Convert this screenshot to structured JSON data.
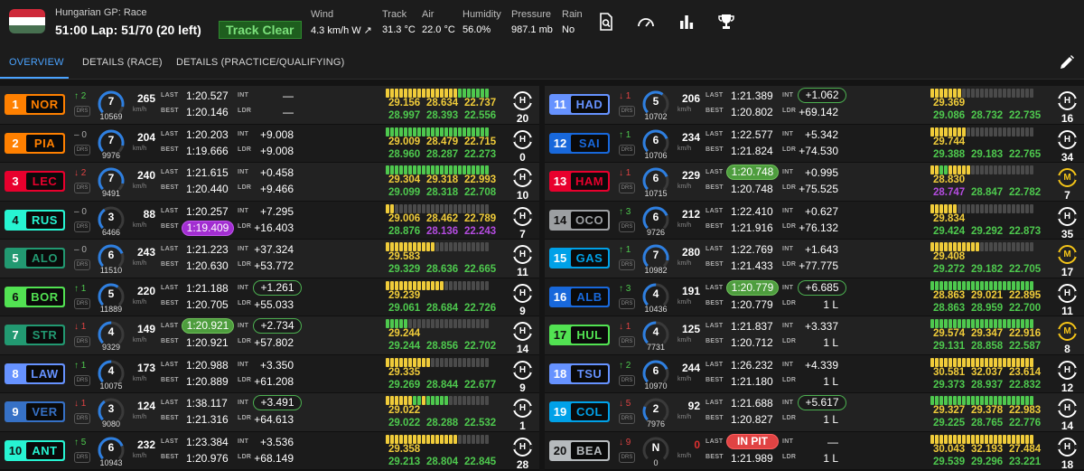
{
  "header": {
    "race_label": "Hungarian GP: Race",
    "lap_text": "51:00 Lap: 51/70 (20 left)",
    "track_status": "Track Clear",
    "weather": [
      {
        "label": "Wind",
        "value": "4.3 km/h W ↗"
      },
      {
        "label": "Track",
        "value": "31.3 °C"
      },
      {
        "label": "Air",
        "value": "22.0 °C"
      },
      {
        "label": "Humidity",
        "value": "56.0%"
      },
      {
        "label": "Pressure",
        "value": "987.1 mb"
      },
      {
        "label": "Rain",
        "value": "No"
      }
    ],
    "toolbar_icons": [
      "search-document-icon",
      "gauge-icon",
      "bar-chart-icon",
      "trophy-icon"
    ]
  },
  "tabs": {
    "overview": "OVERVIEW",
    "details_race": "DETAILS (RACE)",
    "details_pq": "DETAILS (PRACTICE/QUALIFYING)"
  },
  "labels": {
    "last": "LAST",
    "best": "BEST",
    "int": "INT",
    "ldr": "LDR",
    "kmh": "km/h",
    "drs": "DRS"
  },
  "colors": {
    "yellow": "#f0cc3a",
    "green": "#4ec94e",
    "purple": "#b44ce0",
    "grey": "#4a4a4a"
  },
  "drivers": [
    {
      "pos": "1",
      "code": "NOR",
      "team": "#ff8000",
      "pc": "↑",
      "pv": "2",
      "dir": "up",
      "gear": "7",
      "rpm": "10569",
      "speed": "265",
      "last": "1:20.527",
      "best": "1:20.146",
      "int": "—",
      "ldr": "—",
      "segs": "yyyyyyyyyyyyyyyyggggggg",
      "s1": "29.156",
      "s2": "28.634",
      "s3": "22.737",
      "b1": "28.997",
      "b2": "28.393",
      "b3": "22.556",
      "tyre": "H",
      "age": "20"
    },
    {
      "pos": "2",
      "code": "PIA",
      "team": "#ff8000",
      "pc": "–",
      "pv": "0",
      "dir": "eq",
      "gear": "7",
      "rpm": "9976",
      "speed": "204",
      "last": "1:20.203",
      "best": "1:19.666",
      "int": "+9.008",
      "ldr": "+9.008",
      "segs": "ggggggggggggggggggggggg",
      "s1": "29.009",
      "s2": "28.479",
      "s3": "22.715",
      "b1": "28.960",
      "b2": "28.287",
      "b3": "22.273",
      "tyre": "H",
      "age": "0"
    },
    {
      "pos": "3",
      "code": "LEC",
      "team": "#e8002d",
      "pc": "↓",
      "pv": "2",
      "dir": "down",
      "gear": "7",
      "rpm": "9491",
      "speed": "240",
      "last": "1:21.615",
      "best": "1:20.440",
      "int": "+0.458",
      "ldr": "+9.466",
      "segs": "ggggggggggggggggggggggg",
      "s1": "29.304",
      "s2": "29.318",
      "s3": "22.993",
      "b1": "29.099",
      "b2": "28.318",
      "b3": "22.708",
      "tyre": "H",
      "age": "10"
    },
    {
      "pos": "4",
      "code": "RUS",
      "team": "#27f4d2",
      "pc": "–",
      "pv": "0",
      "dir": "eq",
      "gear": "3",
      "rpm": "6466",
      "speed": "88",
      "last": "1:20.257",
      "best": "1:19.409",
      "bestStyle": "p",
      "int": "+7.295",
      "ldr": "+16.403",
      "segs": "yy---------------------",
      "s1": "29.006",
      "s2": "28.462",
      "s3": "22.789",
      "b1": "28.876",
      "b2": "28.136",
      "b3": "22.243",
      "b2c": "purple",
      "b3c": "purple",
      "tyre": "H",
      "age": "7"
    },
    {
      "pos": "5",
      "code": "ALO",
      "team": "#229971",
      "pc": "–",
      "pv": "0",
      "dir": "eq",
      "gear": "6",
      "rpm": "11510",
      "speed": "243",
      "last": "1:21.223",
      "best": "1:20.630",
      "int": "+37.324",
      "ldr": "+53.772",
      "segs": "yyyyyyyyyyy------------",
      "s1": "29.583",
      "b1": "29.329",
      "b2": "28.636",
      "b3": "22.665",
      "tyre": "H",
      "age": "11"
    },
    {
      "pos": "6",
      "code": "BOR",
      "team": "#52e252",
      "pc": "↑",
      "pv": "1",
      "dir": "up",
      "gear": "5",
      "rpm": "11889",
      "speed": "220",
      "last": "1:21.188",
      "best": "1:20.705",
      "int": "+1.261",
      "intStyle": "o",
      "ldr": "+55.033",
      "segs": "yyyyyyyyyyyyy----------",
      "s1": "29.239",
      "b1": "29.061",
      "b2": "28.684",
      "b3": "22.726",
      "tyre": "H",
      "age": "9"
    },
    {
      "pos": "7",
      "code": "STR",
      "team": "#229971",
      "pc": "↓",
      "pv": "1",
      "dir": "down",
      "gear": "4",
      "rpm": "9329",
      "speed": "149",
      "last": "1:20.921",
      "lastStyle": "g",
      "best": "1:20.921",
      "int": "+2.734",
      "intStyle": "o",
      "ldr": "+57.802",
      "segs": "ggggg------------------",
      "s1": "29.244",
      "b1": "29.244",
      "b2": "28.856",
      "b3": "22.702",
      "tyre": "H",
      "age": "14"
    },
    {
      "pos": "8",
      "code": "LAW",
      "team": "#6692ff",
      "pc": "↑",
      "pv": "1",
      "dir": "up",
      "gear": "4",
      "rpm": "10075",
      "speed": "173",
      "last": "1:20.988",
      "best": "1:20.889",
      "int": "+3.350",
      "ldr": "+61.208",
      "segs": "yyyyyyyyyy-------------",
      "s1": "29.335",
      "b1": "29.269",
      "b2": "28.844",
      "b3": "22.677",
      "tyre": "H",
      "age": "9"
    },
    {
      "pos": "9",
      "code": "VER",
      "team": "#3671c6",
      "pc": "↓",
      "pv": "1",
      "dir": "down",
      "gear": "3",
      "rpm": "9080",
      "speed": "124",
      "last": "1:38.117",
      "best": "1:21.316",
      "int": "+3.491",
      "intStyle": "o",
      "ldr": "+64.613",
      "segs": "yyyyyyggyggggg---------",
      "s1": "29.022",
      "b1": "29.022",
      "b2": "28.288",
      "b3": "22.532",
      "tyre": "H",
      "age": "1"
    },
    {
      "pos": "10",
      "code": "ANT",
      "team": "#27f4d2",
      "pc": "↑",
      "pv": "5",
      "dir": "up",
      "gear": "6",
      "rpm": "10943",
      "speed": "232",
      "last": "1:23.384",
      "best": "1:20.976",
      "int": "+3.536",
      "ldr": "+68.149",
      "segs": "yyyyyyyyyyyyyyyy-------",
      "s1": "29.358",
      "b1": "29.213",
      "b2": "28.804",
      "b3": "22.845",
      "tyre": "H",
      "age": "28"
    },
    {
      "pos": "11",
      "code": "HAD",
      "team": "#6692ff",
      "pc": "↓",
      "pv": "1",
      "dir": "down",
      "gear": "5",
      "rpm": "10702",
      "speed": "206",
      "last": "1:21.389",
      "best": "1:20.802",
      "int": "+1.062",
      "intStyle": "o",
      "ldr": "+69.142",
      "segs": "yyyyyyy----------------",
      "s1": "29.369",
      "b1": "29.086",
      "b2": "28.732",
      "b3": "22.735",
      "tyre": "H",
      "age": "16"
    },
    {
      "pos": "12",
      "code": "SAI",
      "team": "#1868db",
      "pc": "↑",
      "pv": "1",
      "dir": "up",
      "gear": "6",
      "rpm": "10706",
      "speed": "234",
      "last": "1:22.577",
      "best": "1:21.824",
      "int": "+5.342",
      "ldr": "+74.530",
      "segs": "yyyyyyyy---------------",
      "s1": "29.744",
      "b1": "29.388",
      "b2": "29.183",
      "b3": "22.765",
      "tyre": "H",
      "age": "34"
    },
    {
      "pos": "13",
      "code": "HAM",
      "team": "#e8002d",
      "pc": "↓",
      "pv": "1",
      "dir": "down",
      "gear": "6",
      "rpm": "10715",
      "speed": "229",
      "last": "1:20.748",
      "lastStyle": "g",
      "best": "1:20.748",
      "int": "+0.995",
      "ldr": "+75.525",
      "segs": "yyggyyyyy--------------",
      "s1": "28.830",
      "b1": "28.747",
      "b1c": "purple",
      "b2": "28.847",
      "b3": "22.782",
      "tyre": "M",
      "age": "7"
    },
    {
      "pos": "14",
      "code": "OCO",
      "team": "#9c9fa2",
      "pc": "↑",
      "pv": "3",
      "dir": "up",
      "gear": "6",
      "rpm": "9726",
      "speed": "212",
      "last": "1:22.410",
      "best": "1:21.916",
      "int": "+0.627",
      "ldr": "+76.132",
      "segs": "yyyyyy-----------------",
      "s1": "29.834",
      "b1": "29.424",
      "b2": "29.292",
      "b3": "22.873",
      "tyre": "H",
      "age": "35"
    },
    {
      "pos": "15",
      "code": "GAS",
      "team": "#00a1e8",
      "pc": "↑",
      "pv": "1",
      "dir": "up",
      "gear": "7",
      "rpm": "10982",
      "speed": "280",
      "last": "1:22.769",
      "best": "1:21.433",
      "int": "+1.643",
      "ldr": "+77.775",
      "segs": "yyyyyyyyyyy------------",
      "s1": "29.408",
      "b1": "29.272",
      "b2": "29.182",
      "b3": "22.705",
      "tyre": "M",
      "age": "17"
    },
    {
      "pos": "16",
      "code": "ALB",
      "team": "#1868db",
      "pc": "↑",
      "pv": "3",
      "dir": "up",
      "gear": "4",
      "rpm": "10436",
      "speed": "191",
      "last": "1:20.779",
      "lastStyle": "g",
      "best": "1:20.779",
      "int": "+6.685",
      "intStyle": "o",
      "ldr": "1 L",
      "segs": "ggggggggggggggggggggggg",
      "s1": "28.863",
      "s2": "29.021",
      "s3": "22.895",
      "b1": "28.863",
      "b2": "28.959",
      "b3": "22.700",
      "tyre": "H",
      "age": "11"
    },
    {
      "pos": "17",
      "code": "HUL",
      "team": "#52e252",
      "pc": "↓",
      "pv": "1",
      "dir": "down",
      "gear": "4",
      "rpm": "7731",
      "speed": "125",
      "last": "1:21.837",
      "best": "1:20.712",
      "int": "+3.337",
      "ldr": "1 L",
      "segs": "ggggggggggggggggggggggg",
      "s1": "29.574",
      "s2": "29.347",
      "s3": "22.916",
      "b1": "29.131",
      "b2": "28.858",
      "b3": "22.587",
      "tyre": "M",
      "age": "8"
    },
    {
      "pos": "18",
      "code": "TSU",
      "team": "#6692ff",
      "pc": "↑",
      "pv": "2",
      "dir": "up",
      "gear": "6",
      "rpm": "10970",
      "speed": "244",
      "last": "1:26.232",
      "best": "1:21.180",
      "int": "+4.339",
      "ldr": "1 L",
      "segs": "yyyyyyyyyyyyyyyyyyyyyyy",
      "s1": "30.581",
      "s2": "32.037",
      "s3": "23.614",
      "b1": "29.373",
      "b2": "28.937",
      "b3": "22.832",
      "tyre": "H",
      "age": "12"
    },
    {
      "pos": "19",
      "code": "COL",
      "team": "#00a1e8",
      "pc": "↓",
      "pv": "5",
      "dir": "down",
      "gear": "2",
      "rpm": "7976",
      "speed": "92",
      "last": "1:21.688",
      "best": "1:20.827",
      "int": "+5.617",
      "intStyle": "o",
      "ldr": "1 L",
      "segs": "ggggggggggggggggggggggg",
      "s1": "29.327",
      "s2": "29.378",
      "s3": "22.983",
      "b1": "29.225",
      "b2": "28.765",
      "b3": "22.776",
      "tyre": "H",
      "age": "14"
    },
    {
      "pos": "20",
      "code": "BEA",
      "team": "#b6babd",
      "pc": "↓",
      "pv": "9",
      "dir": "down",
      "gear": "N",
      "rpm": "0",
      "speed": "0",
      "speedColor": "#e03030",
      "last": "IN PIT",
      "lastStyle": "r",
      "best": "1:21.989",
      "int": "—",
      "ldr": "1 L",
      "segs": "yyyyyyyyyyyyyyyyyyyyyyy",
      "s1": "30.043",
      "s2": "32.193",
      "s3": "27.484",
      "b1": "29.539",
      "b2": "29.296",
      "b3": "23.221",
      "tyre": "H",
      "age": "18"
    }
  ]
}
